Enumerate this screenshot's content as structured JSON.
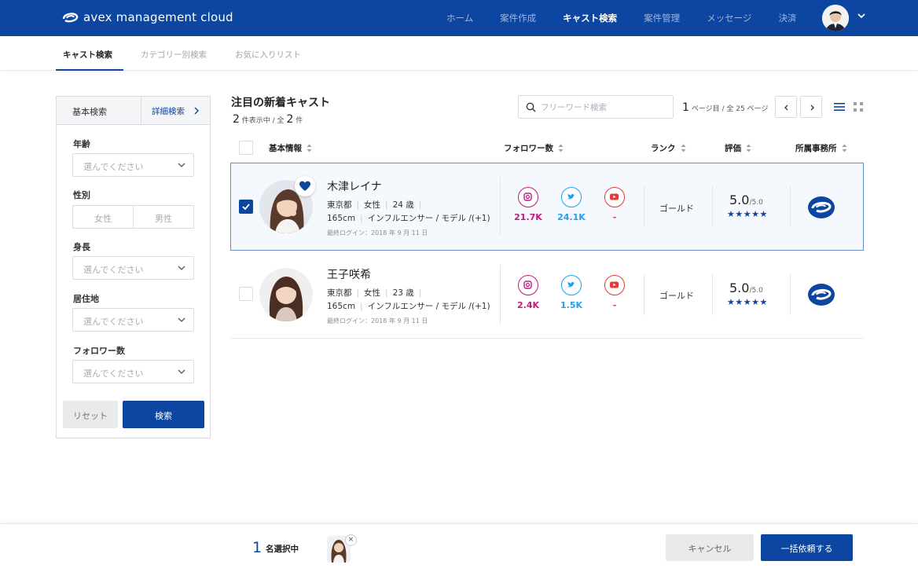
{
  "brand": {
    "name": "avex management cloud"
  },
  "nav": {
    "items": [
      {
        "label": "ホーム",
        "active": false
      },
      {
        "label": "案件作成",
        "active": false
      },
      {
        "label": "キャスト検索",
        "active": true
      },
      {
        "label": "案件管理",
        "active": false
      },
      {
        "label": "メッセージ",
        "active": false
      },
      {
        "label": "決済",
        "active": false
      }
    ]
  },
  "subtabs": [
    {
      "label": "キャスト検索",
      "active": true
    },
    {
      "label": "カテゴリー別検索",
      "active": false
    },
    {
      "label": "お気に入りリスト",
      "active": false
    }
  ],
  "filter": {
    "basic_label": "基本検索",
    "detail_label": "詳細検索",
    "age_label": "年齢",
    "gender_label": "性別",
    "height_label": "身長",
    "residence_label": "居住地",
    "followers_label": "フォロワー数",
    "select_placeholder": "選んでください",
    "gender_female": "女性",
    "gender_male": "男性",
    "reset_label": "リセット",
    "search_label": "検索"
  },
  "main": {
    "title": "注目の新着キャスト",
    "shown_count": "2",
    "shown_text": "件表示中 / 全",
    "total_count": "2",
    "total_text": "件",
    "search_placeholder": "フリーワード検索",
    "page_current": "1",
    "page_text": "ページ目 / 全 25 ページ"
  },
  "columns": {
    "basic": "基本情報",
    "followers": "フォロワー数",
    "rank": "ランク",
    "rating": "評価",
    "agency": "所属事務所"
  },
  "casts": [
    {
      "name": "木津レイナ",
      "location": "東京都",
      "gender": "女性",
      "age": "24 歳",
      "height": "165cm",
      "category": "インフルエンサー / モデル /(+1)",
      "last_login": "最終ログイン：2018 年 9 月 11 日",
      "instagram": "21.7K",
      "twitter": "24.1K",
      "youtube": "-",
      "rank": "ゴールド",
      "score": "5.0",
      "score_max": "/5.0",
      "stars": "★★★★★",
      "selected": true,
      "favorite": true
    },
    {
      "name": "王子咲希",
      "location": "東京都",
      "gender": "女性",
      "age": "23 歳",
      "height": "165cm",
      "category": "インフルエンサー / モデル /(+1)",
      "last_login": "最終ログイン：2018 年 9 月 11 日",
      "instagram": "2.4K",
      "twitter": "1.5K",
      "youtube": "-",
      "rank": "ゴールド",
      "score": "5.0",
      "score_max": "/5.0",
      "stars": "★★★★★",
      "selected": false,
      "favorite": false
    }
  ],
  "footer": {
    "selected_count": "1",
    "selected_label": "名選択中",
    "remove_glyph": "×",
    "cancel_label": "キャンセル",
    "request_label": "一括依頼する"
  },
  "colors": {
    "brand": "#0c46a0",
    "instagram": "#c2187f",
    "twitter": "#1da1f2",
    "youtube": "#e53935"
  }
}
